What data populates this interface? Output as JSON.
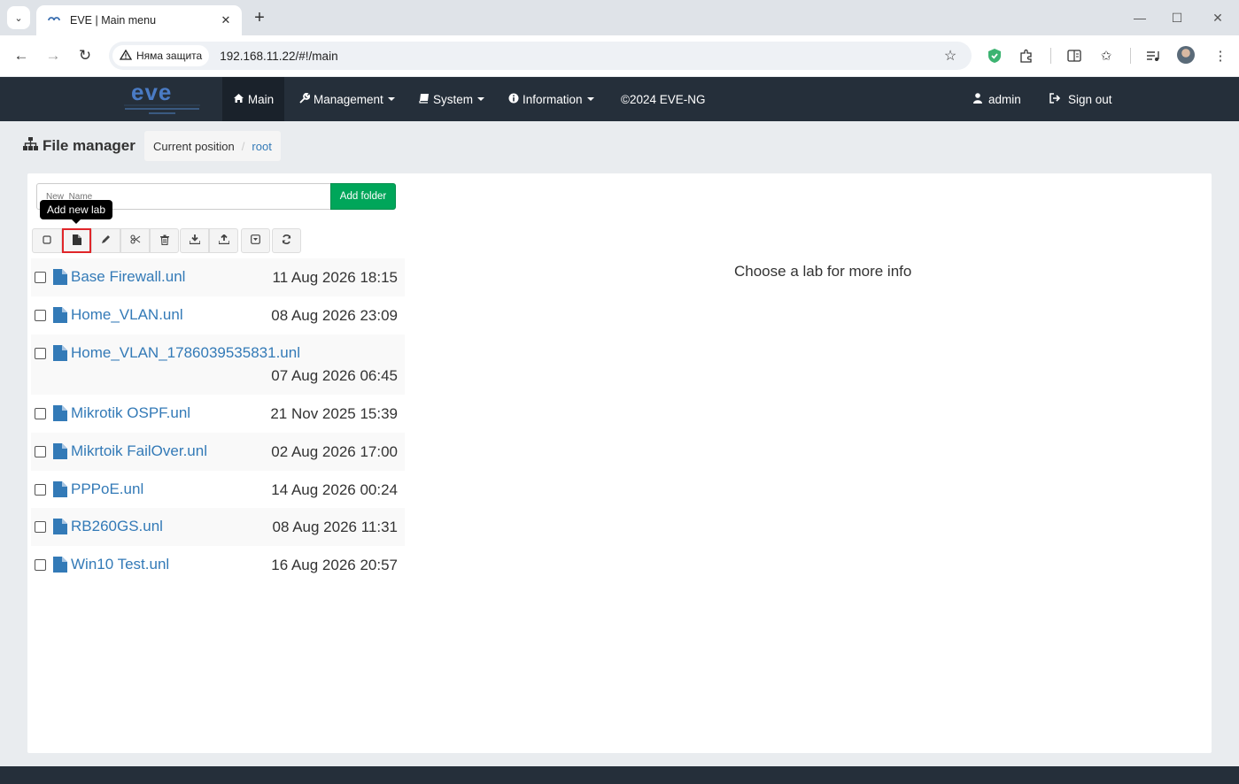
{
  "browser": {
    "tab_title": "EVE | Main menu",
    "security_label": "Няма защита",
    "url": "192.168.11.22/#!/main"
  },
  "navbar": {
    "logo_text": "eve",
    "items": [
      {
        "label": "Main",
        "icon": "home-icon"
      },
      {
        "label": "Management",
        "icon": "wrench-icon"
      },
      {
        "label": "System",
        "icon": "book-icon"
      },
      {
        "label": "Information",
        "icon": "info-circle-icon"
      },
      {
        "label": "©2024 EVE-NG"
      }
    ],
    "user": "admin",
    "sign_out": "Sign out"
  },
  "page": {
    "title": "File manager",
    "breadcrumb": {
      "current": "Current position",
      "root": "root"
    }
  },
  "folder_form": {
    "placeholder": "New_Name",
    "add_button": "Add folder"
  },
  "toolbar": {
    "tooltip": "Add new lab",
    "buttons": [
      "select-all",
      "add-lab",
      "rename",
      "cut",
      "delete",
      "import",
      "export",
      "collapse",
      "refresh"
    ]
  },
  "files": [
    {
      "name": "Base Firewall.unl",
      "date": "11 Aug 2026 18:15"
    },
    {
      "name": "Home_VLAN.unl",
      "date": "08 Aug 2026 23:09"
    },
    {
      "name": "Home_VLAN_1786039535831.unl",
      "date": "07 Aug 2026 06:45"
    },
    {
      "name": "Mikrotik OSPF.unl",
      "date": "21 Nov 2025 15:39"
    },
    {
      "name": "Mikrtoik FailOver.unl",
      "date": "02 Aug 2026 17:00"
    },
    {
      "name": "PPPoE.unl",
      "date": "14 Aug 2026 00:24"
    },
    {
      "name": "RB260GS.unl",
      "date": "08 Aug 2026 11:31"
    },
    {
      "name": "Win10 Test.unl",
      "date": "16 Aug 2026 20:57"
    }
  ],
  "info_message": "Choose a lab for more info",
  "colors": {
    "navbar": "#252f3a",
    "link": "#337ab7",
    "add_folder": "#00a65a",
    "highlight": "#e0262a"
  }
}
